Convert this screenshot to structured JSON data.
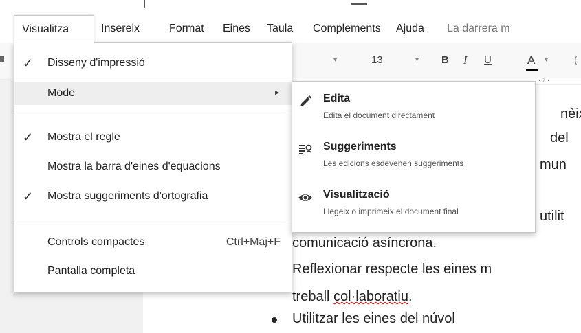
{
  "menubar": {
    "items": [
      {
        "label": "Visualitza"
      },
      {
        "label": "Insereix"
      },
      {
        "label": "Format"
      },
      {
        "label": "Eines"
      },
      {
        "label": "Taula"
      },
      {
        "label": "Complements"
      },
      {
        "label": "Ajuda"
      },
      {
        "label": "La darrera m"
      }
    ]
  },
  "toolbar": {
    "font_size": "13",
    "bold": "B",
    "italic": "I",
    "underline": "U",
    "text_color": "A",
    "caret": "▾",
    "cut_letter": "("
  },
  "ruler": {
    "mark": "· 7 ·"
  },
  "view_menu": {
    "items": [
      {
        "label": "Disseny d'impressió",
        "checked": true
      },
      {
        "label": "Mode",
        "submenu": true
      },
      {
        "label": "Mostra el regle",
        "checked": true
      },
      {
        "label": "Mostra la barra d'eines d'equacions",
        "checked": false
      },
      {
        "label": "Mostra suggeriments d'ortografia",
        "checked": true
      },
      {
        "label": "Controls compactes",
        "shortcut": "Ctrl+Maj+F"
      },
      {
        "label": "Pantalla completa"
      }
    ],
    "check_glyph": "✓",
    "submenu_arrow": "►"
  },
  "mode_submenu": {
    "options": [
      {
        "title": "Edita",
        "description": "Edita el document directament",
        "icon": "pencil-icon"
      },
      {
        "title": "Suggeriments",
        "description": "Les edicions esdevenen suggeriments",
        "icon": "suggest-icon"
      },
      {
        "title": "Visualització",
        "description": "Llegeix o imprimeix el document final",
        "icon": "eye-icon"
      }
    ]
  },
  "document": {
    "fragments": [
      "nèix",
      "del",
      "mun",
      "utilit"
    ],
    "line1": "comunicació asíncrona.",
    "line2": "Reflexionar respecte les eines m",
    "line3_prefix": "treball ",
    "line3_underlined": "col·laboratiu",
    "line3_suffix": ".",
    "bullet_line": "Utilitzar   les   eines   del   núvol"
  }
}
